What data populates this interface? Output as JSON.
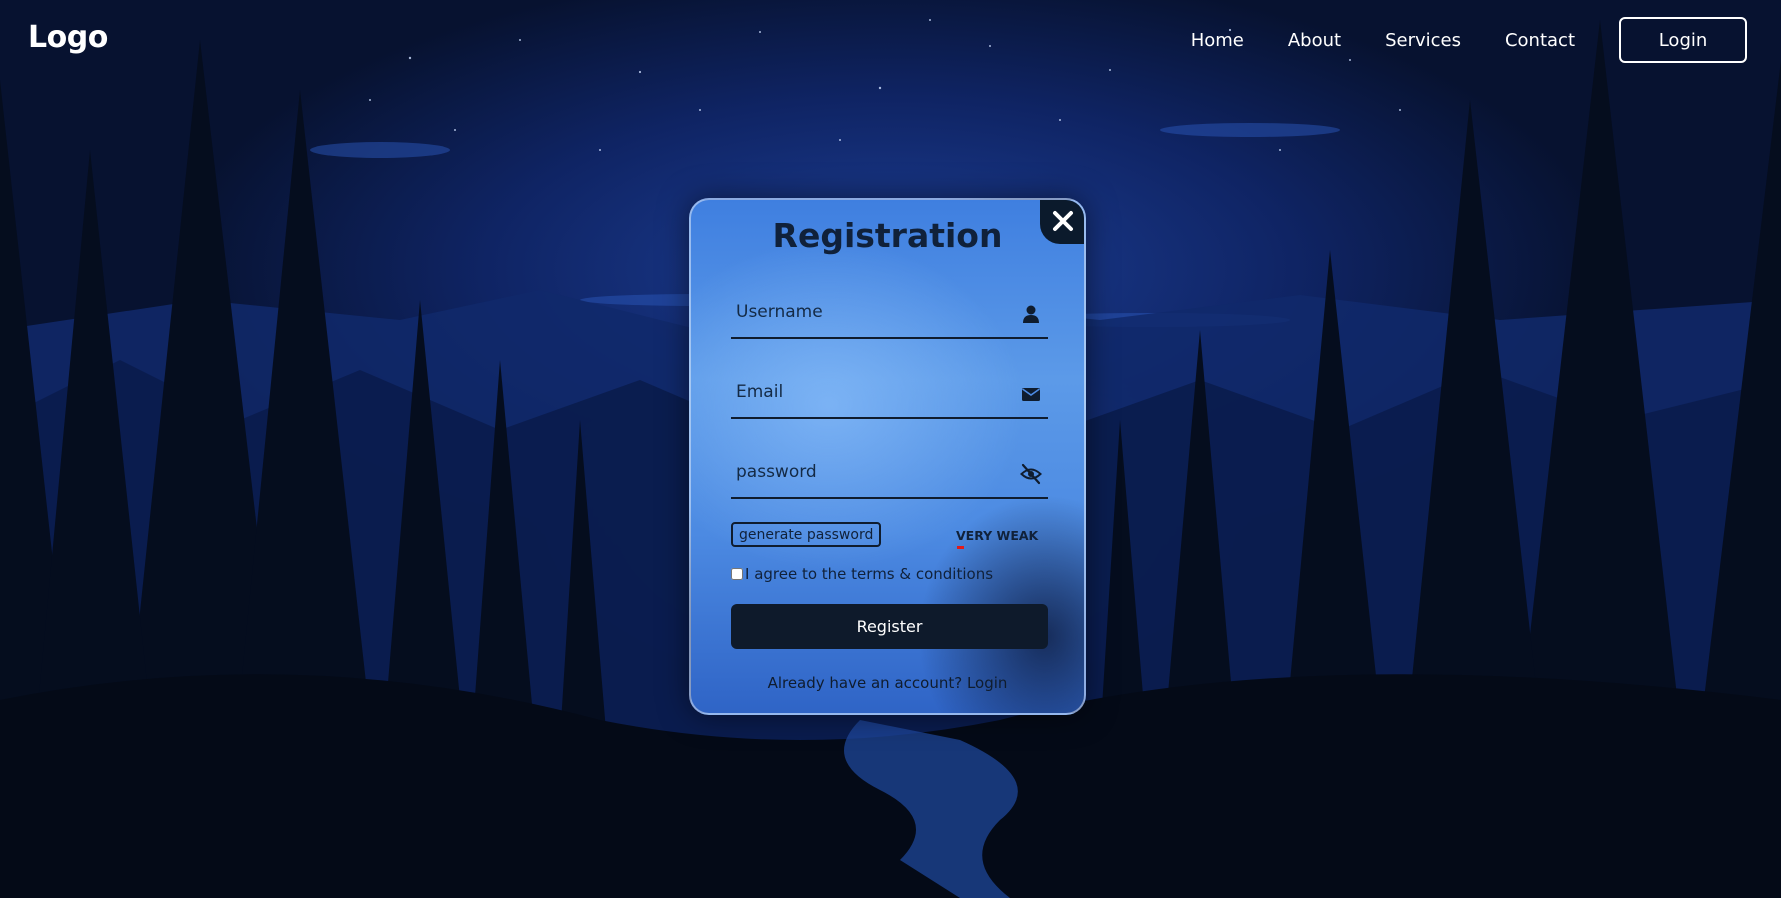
{
  "header": {
    "logo": "Logo",
    "nav": [
      "Home",
      "About",
      "Services",
      "Contact"
    ],
    "login_button": "Login"
  },
  "modal": {
    "title": "Registration",
    "close_icon": "close-icon",
    "fields": {
      "username": {
        "placeholder": "Username",
        "value": "",
        "icon": "user-icon"
      },
      "email": {
        "placeholder": "Email",
        "value": "",
        "icon": "envelope-icon"
      },
      "password": {
        "placeholder": "password",
        "value": "",
        "icon": "eye-slash-icon"
      }
    },
    "generate_password_label": "generate password",
    "strength": {
      "label": "VERY WEAK",
      "level": 0.12,
      "color": "#e01b1b"
    },
    "terms_label": "I agree to the terms & conditions",
    "terms_checked": false,
    "register_label": "Register",
    "footer_text": "Already have an account?",
    "footer_link": "Login"
  },
  "colors": {
    "accent_dark": "#0e1a2b",
    "modal_blue": "#4c8ae2",
    "background": "#071230"
  }
}
